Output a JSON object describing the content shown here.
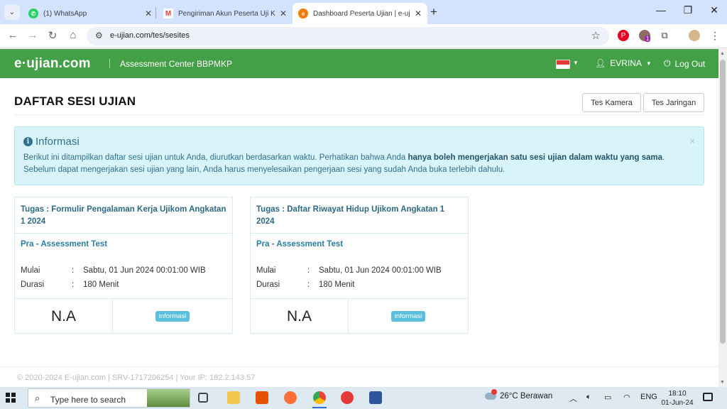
{
  "browser": {
    "tabs": [
      {
        "title": "(1) WhatsApp",
        "icon": "whatsapp-icon",
        "color": "#25d366"
      },
      {
        "title": "Pengiriman Akun Peserta Uji Ko",
        "icon": "gmail-icon",
        "color": "#ea4335"
      },
      {
        "title": "Dashboard Peserta Ujian | e-uji",
        "icon": "e-ujian-icon",
        "color": "#f57c00"
      }
    ],
    "url": "e-ujian.com/tes/sesites",
    "extension_badge": "1"
  },
  "header": {
    "logo": "e·ujian.com",
    "center_name": "Assessment Center BBPMKP",
    "user_name": "EVRINA",
    "logout_label": "Log Out",
    "brand_color": "#43a047"
  },
  "page": {
    "title": "DAFTAR SESI UJIAN",
    "buttons": {
      "camera": "Tes Kamera",
      "network": "Tes Jaringan"
    },
    "alert": {
      "heading": "Informasi",
      "close": "×",
      "text_1": "Berikut ini ditampilkan daftar sesi ujian untuk Anda, diurutkan berdasarkan waktu. Perhatikan bahwa Anda ",
      "text_bold": "hanya boleh mengerjakan satu sesi ujian dalam waktu yang sama",
      "text_2": ". Sebelum dapat mengerjakan sesi ujian yang lain, Anda harus menyelesaikan pengerjaan sesi yang sudah Anda buka terlebih dahulu."
    },
    "sessions": [
      {
        "title": "Tugas : Formulir Pengalaman Kerja Ujikom Angkatan 1 2024",
        "subtitle": "Pra - Assessment Test",
        "start_label": "Mulai",
        "start_value": "Sabtu, 01 Jun 2024 00:01:00 WIB",
        "duration_label": "Durasi",
        "duration_value": "180 Menit",
        "score": "N.A",
        "badge": "informasi"
      },
      {
        "title": "Tugas : Daftar Riwayat Hidup Ujikom Angkatan 1 2024",
        "subtitle": "Pra - Assessment Test",
        "start_label": "Mulai",
        "start_value": "Sabtu, 01 Jun 2024 00:01:00 WIB",
        "duration_label": "Durasi",
        "duration_value": "180 Menit",
        "score": "N.A",
        "badge": "informasi"
      }
    ],
    "colon": ":",
    "footer": "© 2020-2024 E-ujian.com | SRV-1717206254 | Your IP: 182.2.143.57"
  },
  "taskbar": {
    "search_placeholder": "Type here to search",
    "weather": "26°C  Berawan",
    "language": "ENG",
    "time": "18:10",
    "date": "01-Jun-24"
  }
}
